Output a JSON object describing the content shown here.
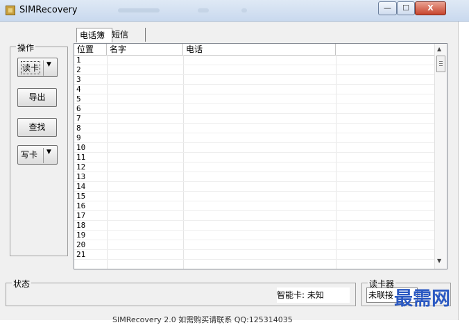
{
  "window": {
    "title": "SIMRecovery",
    "min_symbol": "—",
    "max_symbol": "☐",
    "close_symbol": "X"
  },
  "tabs": [
    "电话簿",
    "短信"
  ],
  "operations": {
    "group_label": "操作",
    "read_card": "读卡",
    "export": "导出",
    "find": "查找",
    "write_card": "写卡",
    "dropdown_arrow": "▼"
  },
  "table": {
    "columns": [
      "位置",
      "名字",
      "电话",
      ""
    ],
    "rows": [
      "1",
      "2",
      "3",
      "4",
      "5",
      "6",
      "7",
      "8",
      "9",
      "10",
      "11",
      "12",
      "13",
      "14",
      "15",
      "16",
      "17",
      "18",
      "19",
      "20",
      "21"
    ]
  },
  "status": {
    "group_label": "状态",
    "smart_card": "智能卡: 未知"
  },
  "reader": {
    "group_label": "读卡器",
    "value": "未联接"
  },
  "watermark": "最需网",
  "footer": "SIMRecovery 2.0   如需购买请联系 QQ:125314035"
}
